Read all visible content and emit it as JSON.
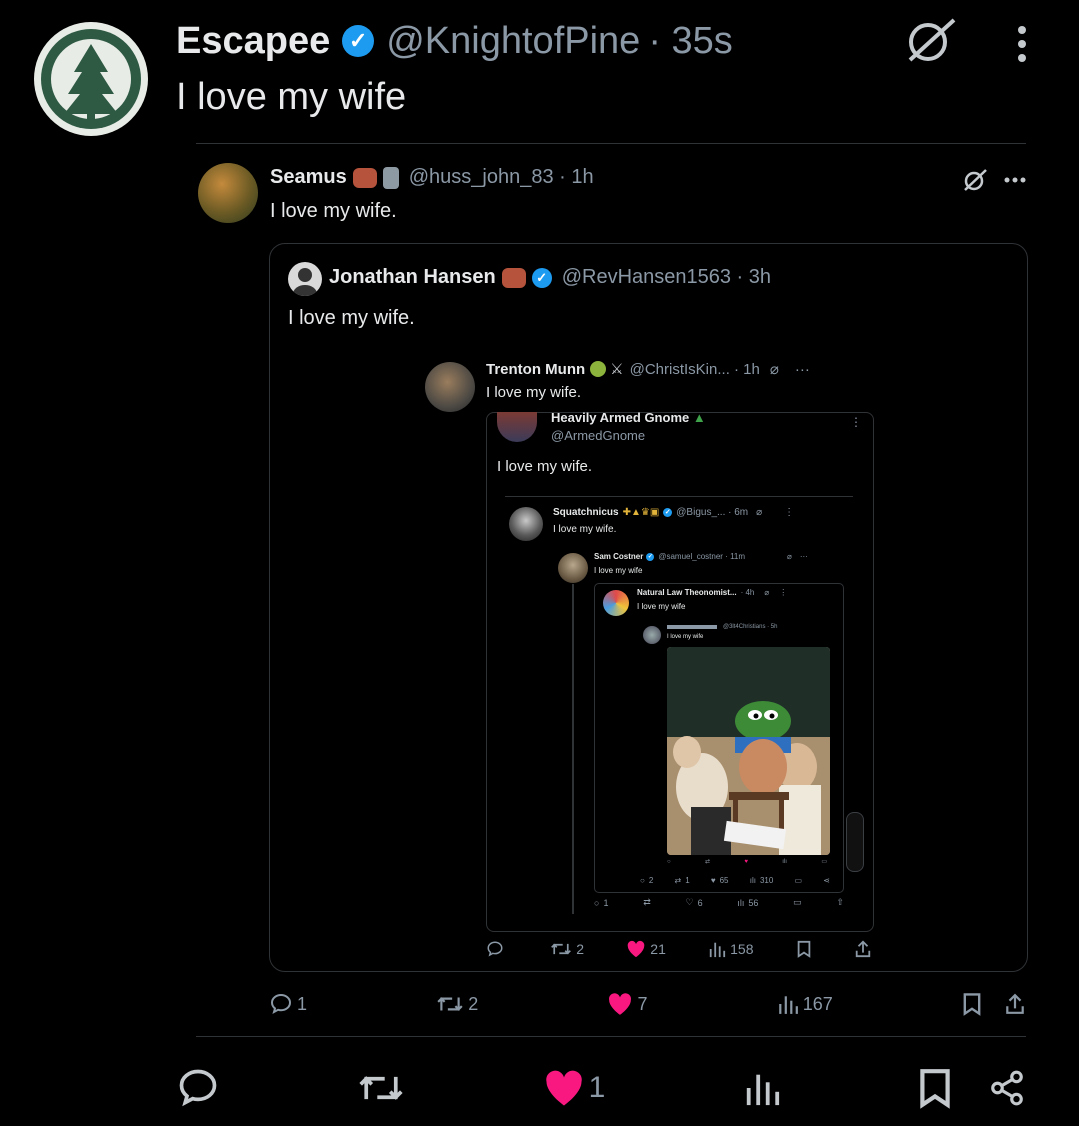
{
  "main": {
    "name": "Escapee",
    "handle": "@KnightofPine",
    "time": "· 35s",
    "text": "I love my wife",
    "actions": {
      "like_count": "1"
    }
  },
  "q1": {
    "name": "Seamus",
    "handle": "@huss_john_83 · 1h",
    "text": "I love my wife.",
    "actions": {
      "replies": "1",
      "reposts": "2",
      "likes": "7",
      "views": "167"
    }
  },
  "q2": {
    "name": "Jonathan Hansen",
    "handle": "@RevHansen1563 · 3h",
    "text": "I love my wife.",
    "actions": {
      "replies": "",
      "reposts": "2",
      "likes": "21",
      "views": "158"
    }
  },
  "q3": {
    "name": "Trenton Munn",
    "handle": "@ChristIsKin... · 1h",
    "text": "I love my wife."
  },
  "q4": {
    "name": "Heavily Armed Gnome",
    "handle": "@ArmedGnome",
    "text": "I love my wife.",
    "actions": {
      "replies": "1",
      "reposts": "",
      "likes": "6",
      "views": "56"
    }
  },
  "q5": {
    "name": "Squatchnicus",
    "handle": "@Bigus_... · 6m",
    "text": "I love my wife."
  },
  "q6": {
    "name": "Sam Costner",
    "handle": "@samuel_costner · 11m",
    "text": "I love my wife"
  },
  "q7": {
    "name": "Natural Law Theonomist...",
    "handle": "· 4h",
    "text": "I love my wife",
    "actions": {
      "replies": "2",
      "reposts": "1",
      "likes": "65",
      "views": "310"
    }
  },
  "q8": {
    "name": "",
    "handle": "@3lt4Christians · 5h",
    "text": "I love my wife"
  },
  "colors": {
    "accent": "#1d9bf0",
    "like": "#f91880",
    "muted": "#8b98a5",
    "border": "#2f3336"
  },
  "icons": [
    "verified-badge-icon",
    "grok-icon",
    "more-icon",
    "reply-icon",
    "repost-icon",
    "heart-icon",
    "views-icon",
    "bookmark-icon",
    "share-icon"
  ]
}
